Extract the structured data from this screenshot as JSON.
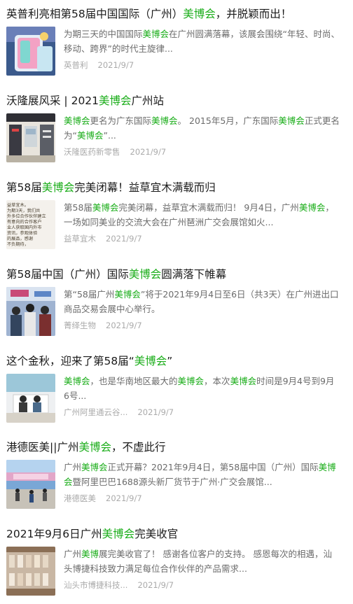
{
  "colors": {
    "highlight": "#1aad19",
    "snippet": "#6b6b6b",
    "meta": "#aaaaaa"
  },
  "results": [
    {
      "title": [
        "英普利亮相第58届中国国际（广州）",
        "美博会",
        "，并脱颖而出！"
      ],
      "snippet": [
        "为期三天的中国国际",
        "美博会",
        "在广州圆满落幕，该展会围绕“年轻、时尚、移动、跨界”的时代主旋律..."
      ],
      "source": "英普利",
      "date": "2021/9/7"
    },
    {
      "title": [
        "沃隆展风采 | 2021",
        "美博会",
        "广州站"
      ],
      "snippet": [
        "",
        "美博会",
        "更名为广东国际",
        "美博会",
        "。 2015年5月，广东国际",
        "美博会",
        "正式更名为“",
        "美博会",
        "”..."
      ],
      "source": "沃隆医药新零售",
      "date": "2021/9/7"
    },
    {
      "title": [
        "第58届",
        "美博会",
        "完美闭幕！益草宜木满载而归"
      ],
      "snippet": [
        "第58届",
        "美博会",
        "完美闭幕，益草宜木满载而归！ 9月4日，广州",
        "美博会",
        "，一场如同美业的交流大会在广州琶洲广交会展馆如火..."
      ],
      "source": "益草宜木",
      "date": "2021/9/7"
    },
    {
      "title": [
        "第58届中国（广州）国际",
        "美博会",
        "圆满落下帷幕"
      ],
      "snippet": [
        "第“58届广州",
        "美博会",
        "”将于2021年9月4日至6日（共3天）在广州进出口商品交易会展中心举行。"
      ],
      "source": "菁绎生物",
      "date": "2021/9/7"
    },
    {
      "title": [
        "这个金秋，迎来了第58届“",
        "美博会",
        "”"
      ],
      "snippet": [
        "",
        "美博会",
        "，也是华南地区最大的",
        "美博会",
        "，本次",
        "美博会",
        "时间是9月4号到9月6号..."
      ],
      "source": "广州阿里通云谷...",
      "date": "2021/9/7"
    },
    {
      "title": [
        "港德医美||广州",
        "美博会",
        "，不虚此行"
      ],
      "snippet": [
        "广州",
        "美博会",
        "正式开幕？2021年9月4日，第58届中国（广州）国际",
        "美博会",
        "暨阿里巴巴1688源头新厂货节于广州·广交会展馆..."
      ],
      "source": "港德医美",
      "date": "2021/9/7"
    },
    {
      "title": [
        "2021年9月6日广州",
        "美博会",
        "完美收官"
      ],
      "snippet": [
        "广州",
        "美博",
        "展完美收官了！ 感谢各位客户的支持。 感恩每次的相遇，汕头博捷科技致力满足每位合作伙伴的产品需求..."
      ],
      "source": "汕头市博捷科技...",
      "date": "2021/9/7"
    }
  ],
  "thumb_icons": [
    "product-jar-photo",
    "store-interior-photo",
    "text-poster-photo",
    "expo-crowd-photo",
    "booth-staff-photo",
    "expo-hall-photo",
    "cosmetics-shelf-photo"
  ],
  "thumb_poster_text": [
    "益草宜木。",
    "为期3天，我们共",
    "外多位合作伙伴建立",
    "有意向的合作客户",
    "业人获取国内外市",
    "资讯，参观体验",
    "的展品，感谢",
    "不负期待，"
  ]
}
